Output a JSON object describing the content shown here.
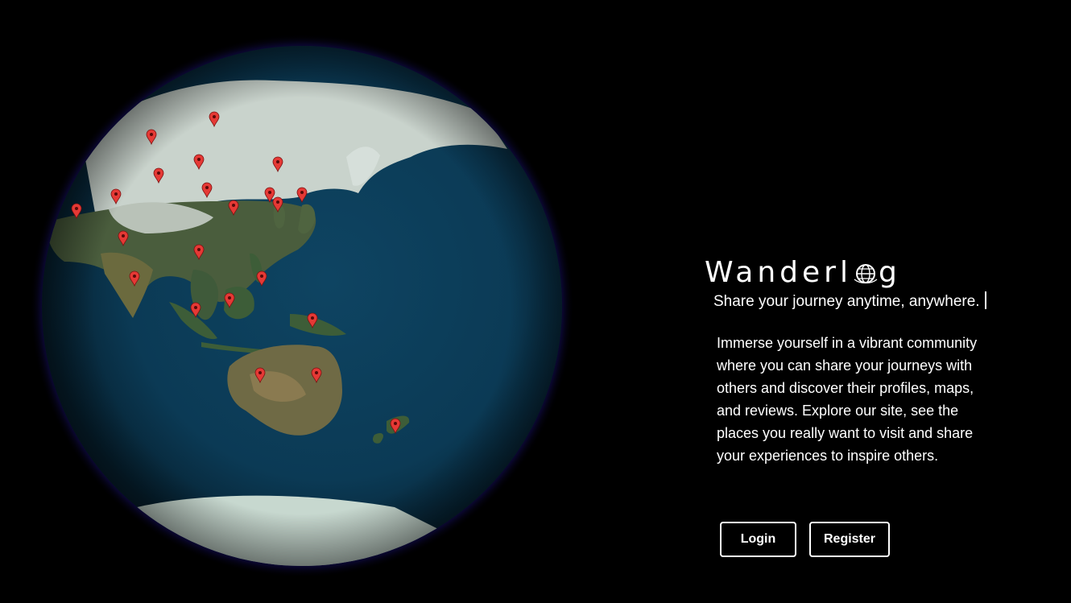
{
  "brand": {
    "prefix": "Wanderl",
    "suffix": "g",
    "logo_icon": "globe-icon"
  },
  "tagline": "Share your journey anytime, anywhere.",
  "description": "Immerse yourself in a vibrant community where you can share your journeys with others and discover their profiles, maps, and reviews. Explore our site, see the places you really want to visit and share your experiences to inspire others.",
  "buttons": {
    "login_label": "Login",
    "register_label": "Register"
  },
  "globe": {
    "ocean_color": "#0b3a55",
    "glow_color": "#2a1f8a",
    "land_color": "#3f5a3a",
    "ice_color": "#d8e2dc",
    "marker_color": "#e53935",
    "marker_icon": "map-pin-icon"
  }
}
